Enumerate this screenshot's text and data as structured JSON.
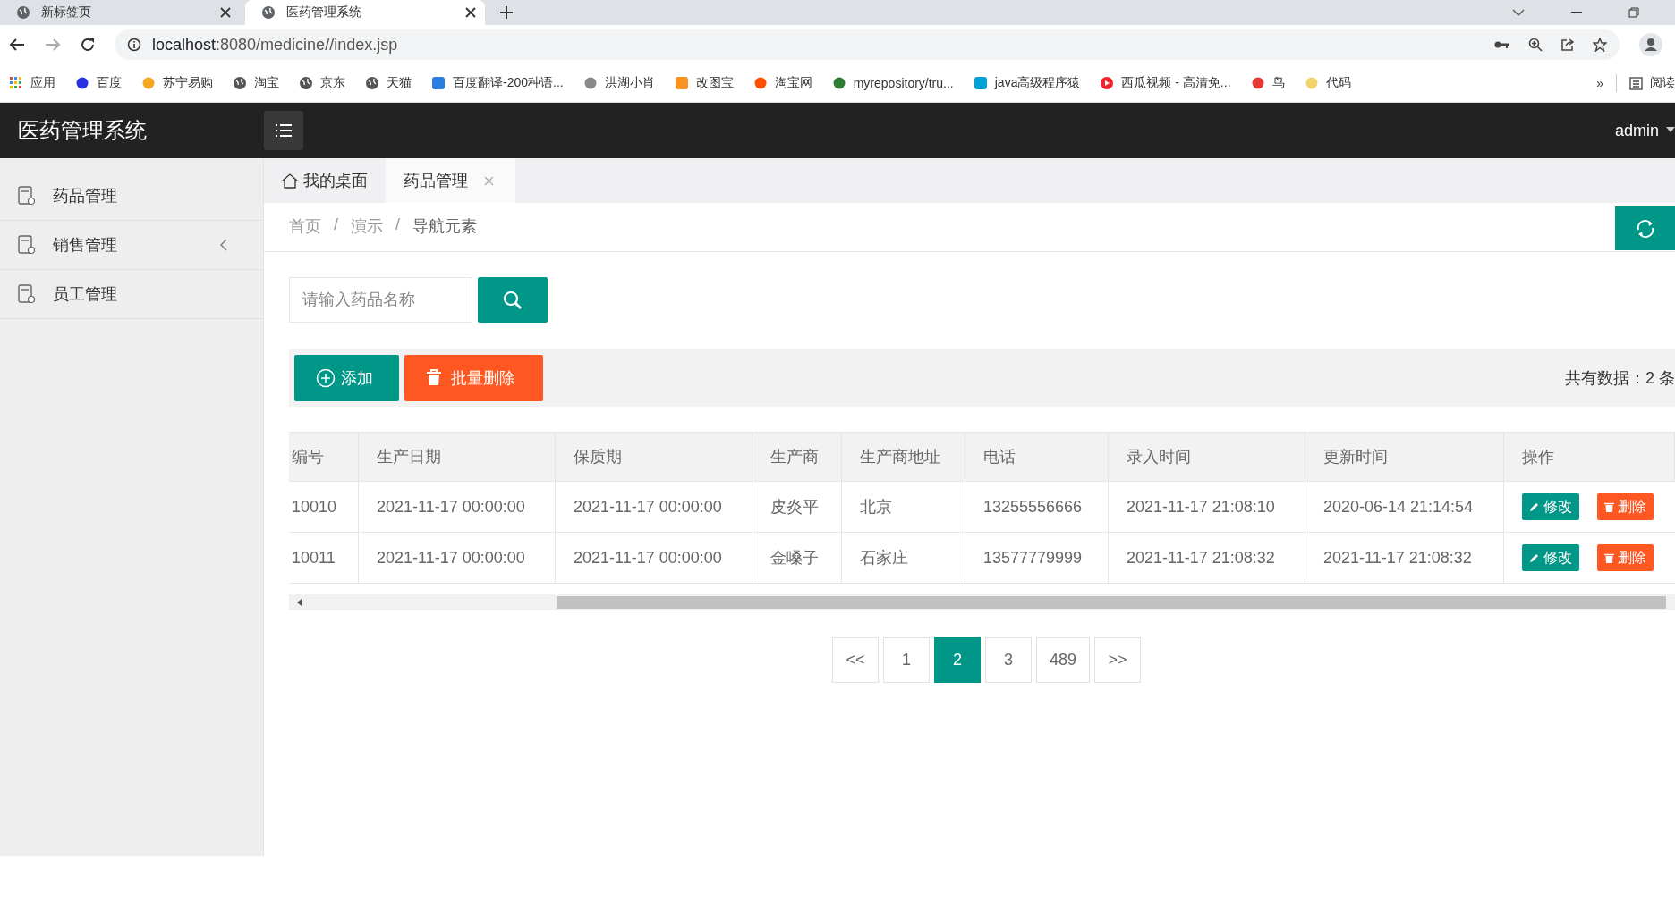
{
  "browser": {
    "tabs": [
      {
        "title": "新标签页",
        "selected": false
      },
      {
        "title": "医药管理系统",
        "selected": true
      }
    ],
    "address": {
      "host": "localhost",
      "path": ":8080/medicine//index.jsp"
    },
    "bookmarks": [
      {
        "label": "应用",
        "kind": "apps"
      },
      {
        "label": "百度",
        "kind": "paw"
      },
      {
        "label": "苏宁易购",
        "kind": "smile"
      },
      {
        "label": "淘宝",
        "kind": "globe"
      },
      {
        "label": "京东",
        "kind": "globe"
      },
      {
        "label": "天猫",
        "kind": "globe"
      },
      {
        "label": "百度翻译-200种语...",
        "kind": "translate"
      },
      {
        "label": "洪湖小肖",
        "kind": "bird"
      },
      {
        "label": "改图宝",
        "kind": "square"
      },
      {
        "label": "淘宝网",
        "kind": "tao"
      },
      {
        "label": "myrepository/tru...",
        "kind": "swirl"
      },
      {
        "label": "java高级程序猿",
        "kind": "tv"
      },
      {
        "label": "西瓜视频 - 高清免...",
        "kind": "play"
      },
      {
        "label": "鸟",
        "kind": "bird2"
      },
      {
        "label": "代码",
        "kind": "half"
      }
    ],
    "overflow": "»",
    "reading_list": "阅读"
  },
  "app": {
    "title": "医药管理系统",
    "user": "admin"
  },
  "sidebar": {
    "items": [
      {
        "label": "药品管理",
        "has_children": false
      },
      {
        "label": "销售管理",
        "has_children": true
      },
      {
        "label": "员工管理",
        "has_children": false
      }
    ]
  },
  "tabs": [
    {
      "label": "我的桌面",
      "selected": false,
      "closable": false
    },
    {
      "label": "药品管理",
      "selected": true,
      "closable": true
    }
  ],
  "breadcrumb": {
    "items": [
      "首页",
      "演示",
      "导航元素"
    ],
    "separator": "/"
  },
  "search": {
    "placeholder": "请输入药品名称"
  },
  "toolbar": {
    "add": "添加",
    "batch_delete": "批量删除",
    "total": "共有数据：2 条"
  },
  "table": {
    "columns": [
      "编号",
      "生产日期",
      "保质期",
      "生产商",
      "生产商地址",
      "电话",
      "录入时间",
      "更新时间",
      "操作"
    ],
    "rows": [
      {
        "cells": [
          "10010",
          "2021-11-17 00:00:00",
          "2021-11-17 00:00:00",
          "皮炎平",
          "北京",
          "13255556666",
          "2021-11-17 21:08:10",
          "2020-06-14 21:14:54"
        ],
        "edit": "修改",
        "delete": "删除"
      },
      {
        "cells": [
          "10011",
          "2021-11-17 00:00:00",
          "2021-11-17 00:00:00",
          "金嗓子",
          "石家庄",
          "13577779999",
          "2021-11-17 21:08:32",
          "2021-11-17 21:08:32"
        ],
        "edit": "修改",
        "delete": "删除"
      }
    ]
  },
  "pagination": {
    "prev": "<<",
    "next": ">>",
    "pages": [
      {
        "label": "1",
        "selected": false
      },
      {
        "label": "2",
        "selected": true
      },
      {
        "label": "3",
        "selected": false
      },
      {
        "label": "489",
        "selected": false
      }
    ]
  }
}
